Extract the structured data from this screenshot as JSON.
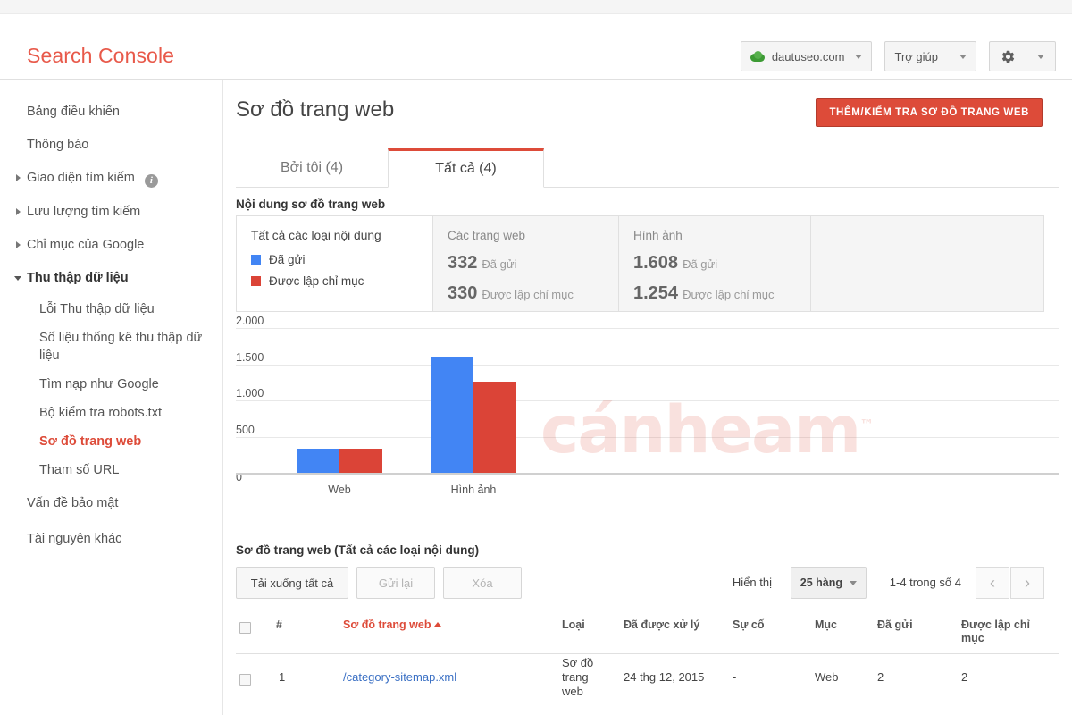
{
  "header": {
    "brand": "Search Console",
    "property_button": "dautuseo.com",
    "help_button": "Trợ giúp",
    "settings_icon": "gear-icon"
  },
  "sidebar": {
    "items": [
      {
        "label": "Bảng điều khiển",
        "type": "plain"
      },
      {
        "label": "Thông báo",
        "type": "plain"
      },
      {
        "label": "Giao diện tìm kiếm",
        "type": "collapsed",
        "info": true
      },
      {
        "label": "Lưu lượng tìm kiếm",
        "type": "collapsed"
      },
      {
        "label": "Chỉ mục của Google",
        "type": "collapsed"
      },
      {
        "label": "Thu thập dữ liệu",
        "type": "expanded"
      }
    ],
    "sub_items": [
      {
        "label": "Lỗi Thu thập dữ liệu",
        "active": false
      },
      {
        "label": "Số liệu thống kê thu thập dữ liệu",
        "active": false
      },
      {
        "label": "Tìm nạp như Google",
        "active": false
      },
      {
        "label": "Bộ kiểm tra robots.txt",
        "active": false
      },
      {
        "label": "Sơ đồ trang web",
        "active": true
      },
      {
        "label": "Tham số URL",
        "active": false
      }
    ],
    "footer_items": [
      {
        "label": "Vấn đề bảo mật"
      },
      {
        "label": "Tài nguyên khác"
      }
    ]
  },
  "page": {
    "title": "Sơ đồ trang web",
    "primary_button": "THÊM/KIỂM TRA SƠ ĐỒ TRANG WEB",
    "tabs": [
      {
        "label": "Bởi tôi (4)",
        "active": false
      },
      {
        "label": "Tất cả (4)",
        "active": true
      }
    ],
    "section_label": "Nội dung sơ đồ trang web",
    "watermark": "cánheam",
    "watermark_tm": "™"
  },
  "summary": {
    "cards": [
      {
        "title": "Tất cả các loại nội dung",
        "legend": [
          {
            "label": "Đã gửi",
            "color": "#4285f4"
          },
          {
            "label": "Được lập chỉ mục",
            "color": "#db4437"
          }
        ]
      },
      {
        "title": "Các trang web",
        "stats": [
          {
            "value": "332",
            "label": "Đã gửi"
          },
          {
            "value": "330",
            "label": "Được lập chỉ mục"
          }
        ]
      },
      {
        "title": "Hình ảnh",
        "stats": [
          {
            "value": "1.608",
            "label": "Đã gửi"
          },
          {
            "value": "1.254",
            "label": "Được lập chỉ mục"
          }
        ]
      }
    ]
  },
  "chart_data": {
    "type": "bar",
    "title": "",
    "categories": [
      "Web",
      "Hình ảnh"
    ],
    "series": [
      {
        "name": "Đã gửi",
        "color": "#4285f4",
        "values": [
          332,
          1608
        ]
      },
      {
        "name": "Được lập chỉ mục",
        "color": "#db4437",
        "values": [
          330,
          1254
        ]
      }
    ],
    "ylim": [
      0,
      2000
    ],
    "yticks": [
      "0",
      "500",
      "1.000",
      "1.500",
      "2.000"
    ],
    "ytick_values": [
      0,
      500,
      1000,
      1500,
      2000
    ],
    "xlabel": "",
    "ylabel": "",
    "grid": true,
    "legend_position": "card-left"
  },
  "table": {
    "title": "Sơ đồ trang web (Tất cả các loại nội dung)",
    "toolbar": {
      "download_all": "Tải xuống tất cả",
      "resubmit": "Gửi lại",
      "delete": "Xóa",
      "show_label": "Hiển thị",
      "rows_select": "25 hàng",
      "range": "1-4 trong số 4",
      "prev_icon": "chevron-left-icon",
      "next_icon": "chevron-right-icon"
    },
    "columns": [
      "#",
      "Sơ đồ trang web",
      "Loại",
      "Đã được xử lý",
      "Sự cố",
      "Mục",
      "Đã gửi",
      "Được lập chỉ mục"
    ],
    "sort_column": "Sơ đồ trang web",
    "rows": [
      {
        "index": "1",
        "sitemap": "/category-sitemap.xml",
        "type": "Sơ đồ trang web",
        "processed": "24 thg 12, 2015",
        "issues": "-",
        "item_type": "Web",
        "submitted": "2",
        "indexed": "2"
      }
    ]
  }
}
